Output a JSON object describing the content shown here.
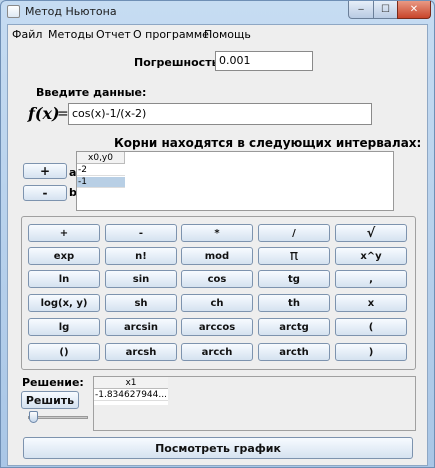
{
  "window": {
    "title": "Метод Ньютона",
    "minimize": "‒",
    "maximize": "☐",
    "close": "✕"
  },
  "menu": [
    "Файл",
    "Методы",
    "Отчет",
    "О программе",
    "Помощь"
  ],
  "error": {
    "label": "Погрешность E =",
    "value": "0.001"
  },
  "input": {
    "prompt": "Введите данные:",
    "fx_label": "f(x)",
    "fx_eq": "=",
    "fx_value": "cos(x)-1/(x-2)"
  },
  "roots": {
    "label": "Корни находятся в следующих интервалах:",
    "plus": "+",
    "minus": "-",
    "a_label": "a",
    "b_label": "b",
    "column": "x0,y0",
    "rows": [
      "-2",
      "-1"
    ]
  },
  "keypad": [
    [
      "+",
      "-",
      "*",
      "/",
      "√"
    ],
    [
      "exp",
      "n!",
      "mod",
      "π",
      "x^y"
    ],
    [
      "ln",
      "sin",
      "cos",
      "tg",
      ","
    ],
    [
      "log(x, y)",
      "sh",
      "ch",
      "th",
      "x"
    ],
    [
      "lg",
      "arcsin",
      "arccos",
      "arctg",
      "("
    ],
    [
      "()",
      "arcsh",
      "arcch",
      "arcth",
      ")"
    ]
  ],
  "solution": {
    "label": "Решение:",
    "solve_button": "Решить",
    "column": "x1",
    "rows": [
      "-1.834627944..."
    ],
    "slider_value": 0
  },
  "graph_button": "Посмотреть график"
}
